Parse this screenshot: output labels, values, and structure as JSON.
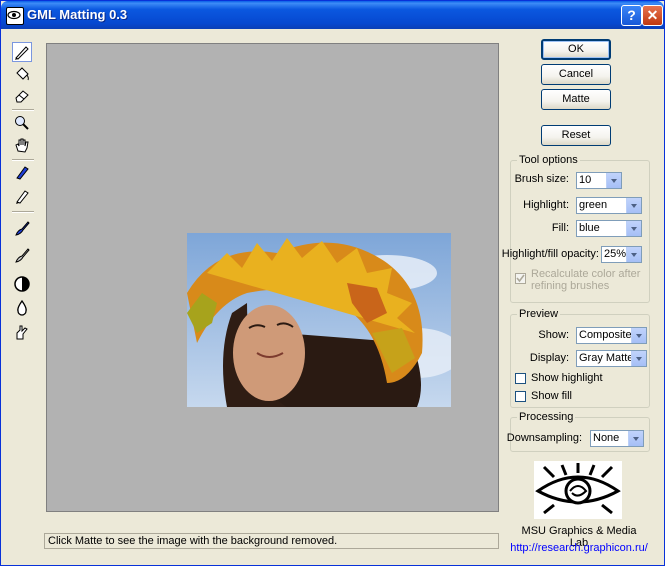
{
  "window": {
    "title": "GML Matting 0.3",
    "help_label": "?",
    "close_label": "✕"
  },
  "toolbar": {
    "tools": [
      "foreground-brush",
      "fill-bucket",
      "eraser",
      "zoom",
      "pan-hand",
      "blue-marker",
      "pencil",
      "blue-brush",
      "gray-brush",
      "contrast",
      "drop",
      "smudge"
    ]
  },
  "buttons": {
    "ok": "OK",
    "cancel": "Cancel",
    "matte": "Matte",
    "reset": "Reset"
  },
  "tool_options": {
    "title": "Tool options",
    "brush_size_label": "Brush size:",
    "brush_size": "10",
    "highlight_label": "Highlight:",
    "highlight": "green",
    "fill_label": "Fill:",
    "fill": "blue",
    "opacity_label": "Highlight/fill opacity:",
    "opacity": "25%",
    "recalc_label_1": "Recalculate color after",
    "recalc_label_2": "refining brushes"
  },
  "preview": {
    "title": "Preview",
    "show_label": "Show:",
    "show": "Composite",
    "display_label": "Display:",
    "display": "Gray Matte",
    "show_highlight": "Show highlight",
    "show_fill": "Show fill"
  },
  "processing": {
    "title": "Processing",
    "downsampling_label": "Downsampling:",
    "downsampling": "None"
  },
  "lab": {
    "name": "MSU Graphics & Media Lab",
    "url": "http://research.graphicon.ru/"
  },
  "status": {
    "text": "Click Matte to see the image with the background removed."
  },
  "colors": {
    "title_bar": "#0a56dc",
    "canvas": "#b2b2b2",
    "link": "#0000ff",
    "face": "#ece9d8"
  }
}
